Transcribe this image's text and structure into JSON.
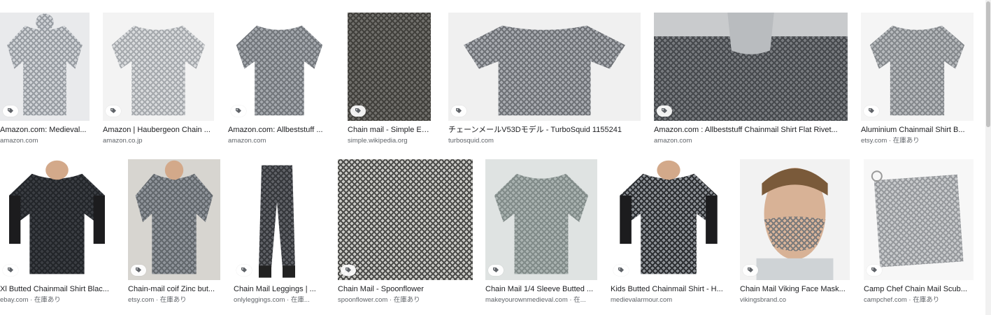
{
  "results": [
    {
      "caption": "Amazon.com: Medieval...",
      "source": "amazon.com",
      "palette": [
        "#cfd2d6",
        "#8f949a",
        "#e9eaec"
      ]
    },
    {
      "caption": "Amazon | Haubergeon Chain ...",
      "source": "amazon.co.jp",
      "palette": [
        "#d8dadc",
        "#9ea2a6",
        "#f3f3f3"
      ]
    },
    {
      "caption": "Amazon.com: Allbeststuff ...",
      "source": "amazon.com",
      "palette": [
        "#a4a8ad",
        "#6c7075",
        "#ffffff"
      ]
    },
    {
      "caption": "Chain mail - Simple En...",
      "source": "simple.wikipedia.org",
      "palette": [
        "#6f6e6a",
        "#3a3935",
        "#9a988f"
      ]
    },
    {
      "caption": "チェーンメールV53Dモデル - TurboSquid 1155241",
      "source": "turbosquid.com",
      "palette": [
        "#a8abb0",
        "#66696e",
        "#f0f0f0"
      ]
    },
    {
      "caption": "Amazon.com : Allbeststuff Chainmail Shirt Flat Rivet...",
      "source": "amazon.com",
      "palette": [
        "#777a7e",
        "#3f4246",
        "#c9cbcd"
      ]
    },
    {
      "caption": "Aluminium Chainmail Shirt B...",
      "source": "etsy.com · 在庫あり",
      "palette": [
        "#b6b9bc",
        "#7d8185",
        "#f5f5f5"
      ]
    },
    {
      "caption": "Xl Butted Chainmail Shirt Blac...",
      "source": "ebay.com · 在庫あり",
      "palette": [
        "#3a3d42",
        "#1f2226",
        "#ffffff"
      ]
    },
    {
      "caption": "Chain-mail coif Zinc but...",
      "source": "etsy.com · 在庫あり",
      "palette": [
        "#8f949a",
        "#5c6166",
        "#d7d5d0"
      ]
    },
    {
      "caption": "Chain Mail Leggings | ...",
      "source": "onlyleggings.com · 在庫...",
      "palette": [
        "#5f6166",
        "#2f3135",
        "#ffffff"
      ]
    },
    {
      "caption": "Chain Mail - Spoonflower",
      "source": "spoonflower.com · 在庫あり",
      "palette": [
        "#c7c7c3",
        "#3a3a38",
        "#e4e4e0"
      ]
    },
    {
      "caption": "Chain Mail 1/4 Sleeve Butted ...",
      "source": "makeyourownmedieval.com · 在...",
      "palette": [
        "#a9b2b0",
        "#7b8583",
        "#dfe3e2"
      ]
    },
    {
      "caption": "Kids Butted Chainmail Shirt - H...",
      "source": "medievalarmour.com",
      "palette": [
        "#8c9095",
        "#1f2124",
        "#ffffff"
      ]
    },
    {
      "caption": "Chain Mail Viking Face Mask...",
      "source": "vikingsbrand.co",
      "palette": [
        "#d9b49a",
        "#6e7276",
        "#f2f2f2"
      ]
    },
    {
      "caption": "Camp Chef Chain Mail Scub...",
      "source": "campchef.com · 在庫あり",
      "palette": [
        "#c9cbcd",
        "#8d9094",
        "#f7f7f7"
      ]
    }
  ]
}
